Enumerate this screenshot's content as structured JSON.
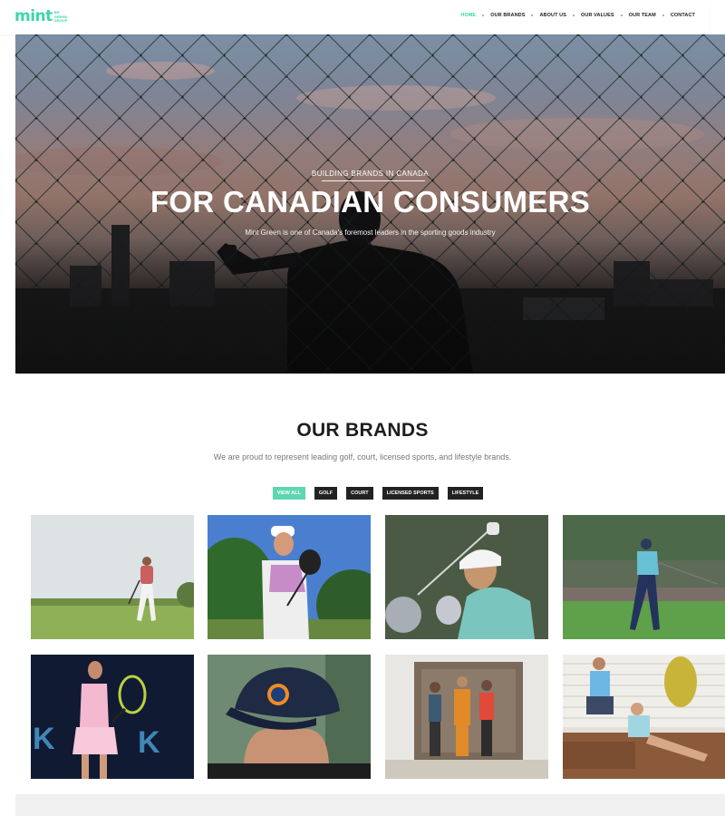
{
  "header": {
    "logo_word": "mint",
    "logo_sub": [
      "BR",
      "GREEN",
      "GROUP"
    ],
    "nav": [
      {
        "label": "HOME",
        "active": true
      },
      {
        "label": "OUR BRANDS",
        "active": false
      },
      {
        "label": "ABOUT US",
        "active": false
      },
      {
        "label": "OUR VALUES",
        "active": false
      },
      {
        "label": "OUR TEAM",
        "active": false
      },
      {
        "label": "CONTACT",
        "active": false
      }
    ]
  },
  "hero": {
    "kicker": "BUILDING BRANDS IN CANADA",
    "title": "FOR CANADIAN CONSUMERS",
    "subtitle": "Mint Green is one of Canada's foremost leaders in the sporting goods industry"
  },
  "brands": {
    "title": "OUR BRANDS",
    "subtitle": "We are proud to represent leading golf, court, licensed sports, and lifestyle brands.",
    "filters": [
      {
        "label": "VIEW ALL",
        "active": true
      },
      {
        "label": "GOLF",
        "active": false
      },
      {
        "label": "COURT",
        "active": false
      },
      {
        "label": "LICENSED SPORTS",
        "active": false
      },
      {
        "label": "LIFESTYLE",
        "active": false
      }
    ],
    "items": [
      {
        "name": "golfer-walking-fairway-photo"
      },
      {
        "name": "golfer-with-driver-photo"
      },
      {
        "name": "golfer-swing-closeup-photo"
      },
      {
        "name": "golfer-follow-through-photo"
      },
      {
        "name": "tennis-player-photo"
      },
      {
        "name": "hockey-cap-photo"
      },
      {
        "name": "lifestyle-group-photo"
      },
      {
        "name": "lifestyle-couple-photo"
      }
    ]
  },
  "colors": {
    "accent": "#3dd6a8",
    "dark": "#222222"
  }
}
